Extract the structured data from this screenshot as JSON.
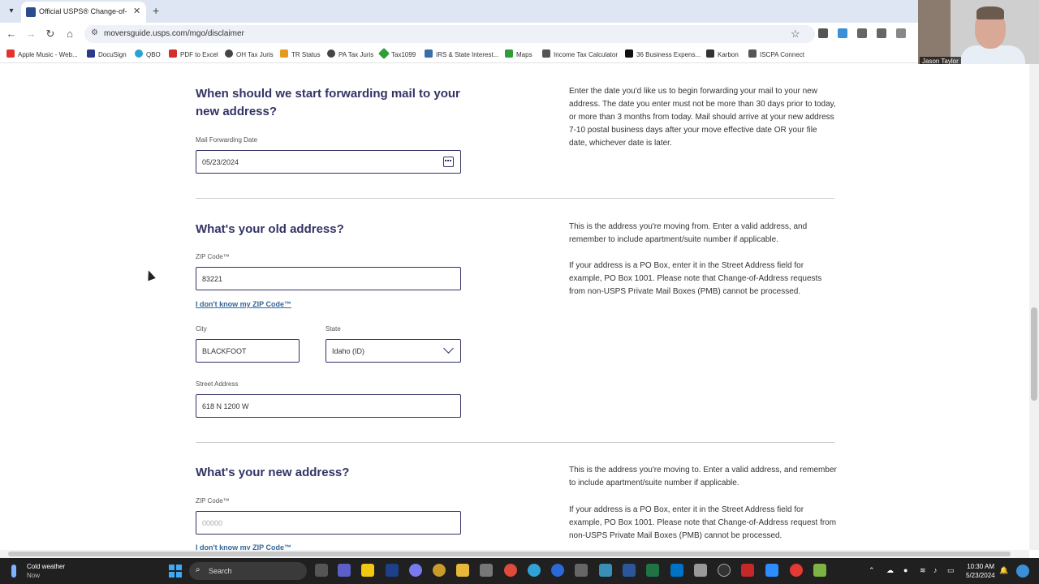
{
  "browser": {
    "tab_title": "Official USPS® Change-of-Add",
    "url": "moversguide.usps.com/mgo/disclaimer",
    "bookmarks": [
      "Apple Music - Web...",
      "DocuSign",
      "QBO",
      "PDF to Excel",
      "OH Tax Juris",
      "TR Status",
      "PA Tax Juris",
      "Tax1099",
      "IRS & State Interest...",
      "Maps",
      "Income Tax Calculator",
      "36 Business Expens...",
      "Karbon",
      "ISCPA Connect"
    ],
    "bookmark_colors": [
      "#e3332e",
      "#2b3a8c",
      "#2aa1d3",
      "#d32f2f",
      "#444444",
      "#e59a1c",
      "#444444",
      "#2e9d3a",
      "#3a6ea5",
      "#2e9d3a",
      "#555555",
      "#111111",
      "#333333",
      "#555555"
    ]
  },
  "webcam": {
    "name": "Jason Taylor"
  },
  "forwarding": {
    "heading": "When should we start forwarding mail to your new address?",
    "date_label": "Mail Forwarding Date",
    "date_value": "05/23/2024",
    "help": "Enter the date you'd like us to begin forwarding your mail to your new address. The date you enter must not be more than 30 days prior to today, or more than 3 months from today. Mail should arrive at your new address 7-10 postal business days after your move effective date OR your file date, whichever date is later."
  },
  "old_address": {
    "heading": "What's your old address?",
    "zip_label": "ZIP Code™",
    "zip_value": "83221",
    "zip_link": "I don't know my ZIP Code™",
    "city_label": "City",
    "city_value": "BLACKFOOT",
    "state_label": "State",
    "state_value": "Idaho (ID)",
    "street_label": "Street Address",
    "street_value": "618 N 1200 W",
    "help1": "This is the address you're moving from. Enter a valid address, and remember to include apartment/suite number if applicable.",
    "help2": "If your address is a PO Box, enter it in the Street Address field for example, PO Box 1001. Please note that Change-of-Address requests from non-USPS Private Mail Boxes (PMB) cannot be processed."
  },
  "new_address": {
    "heading": "What's your new address?",
    "zip_label": "ZIP Code™",
    "zip_placeholder": "00000",
    "zip_link": "I don't know my ZIP Code™",
    "help1": "This is the address you're moving to. Enter a valid address, and remember to include apartment/suite number if applicable.",
    "help2": "If your address is a PO Box, enter it in the Street Address field for example, PO Box 1001. Please note that Change-of-Address request from non-USPS Private Mail Boxes (PMB) cannot be processed."
  },
  "taskbar": {
    "weather": "Cold weather",
    "weather_sub": "Now",
    "search": "Search",
    "time": "10:30 AM",
    "date": "5/23/2024"
  },
  "colors": {
    "heading": "#333366",
    "link": "#336699"
  }
}
